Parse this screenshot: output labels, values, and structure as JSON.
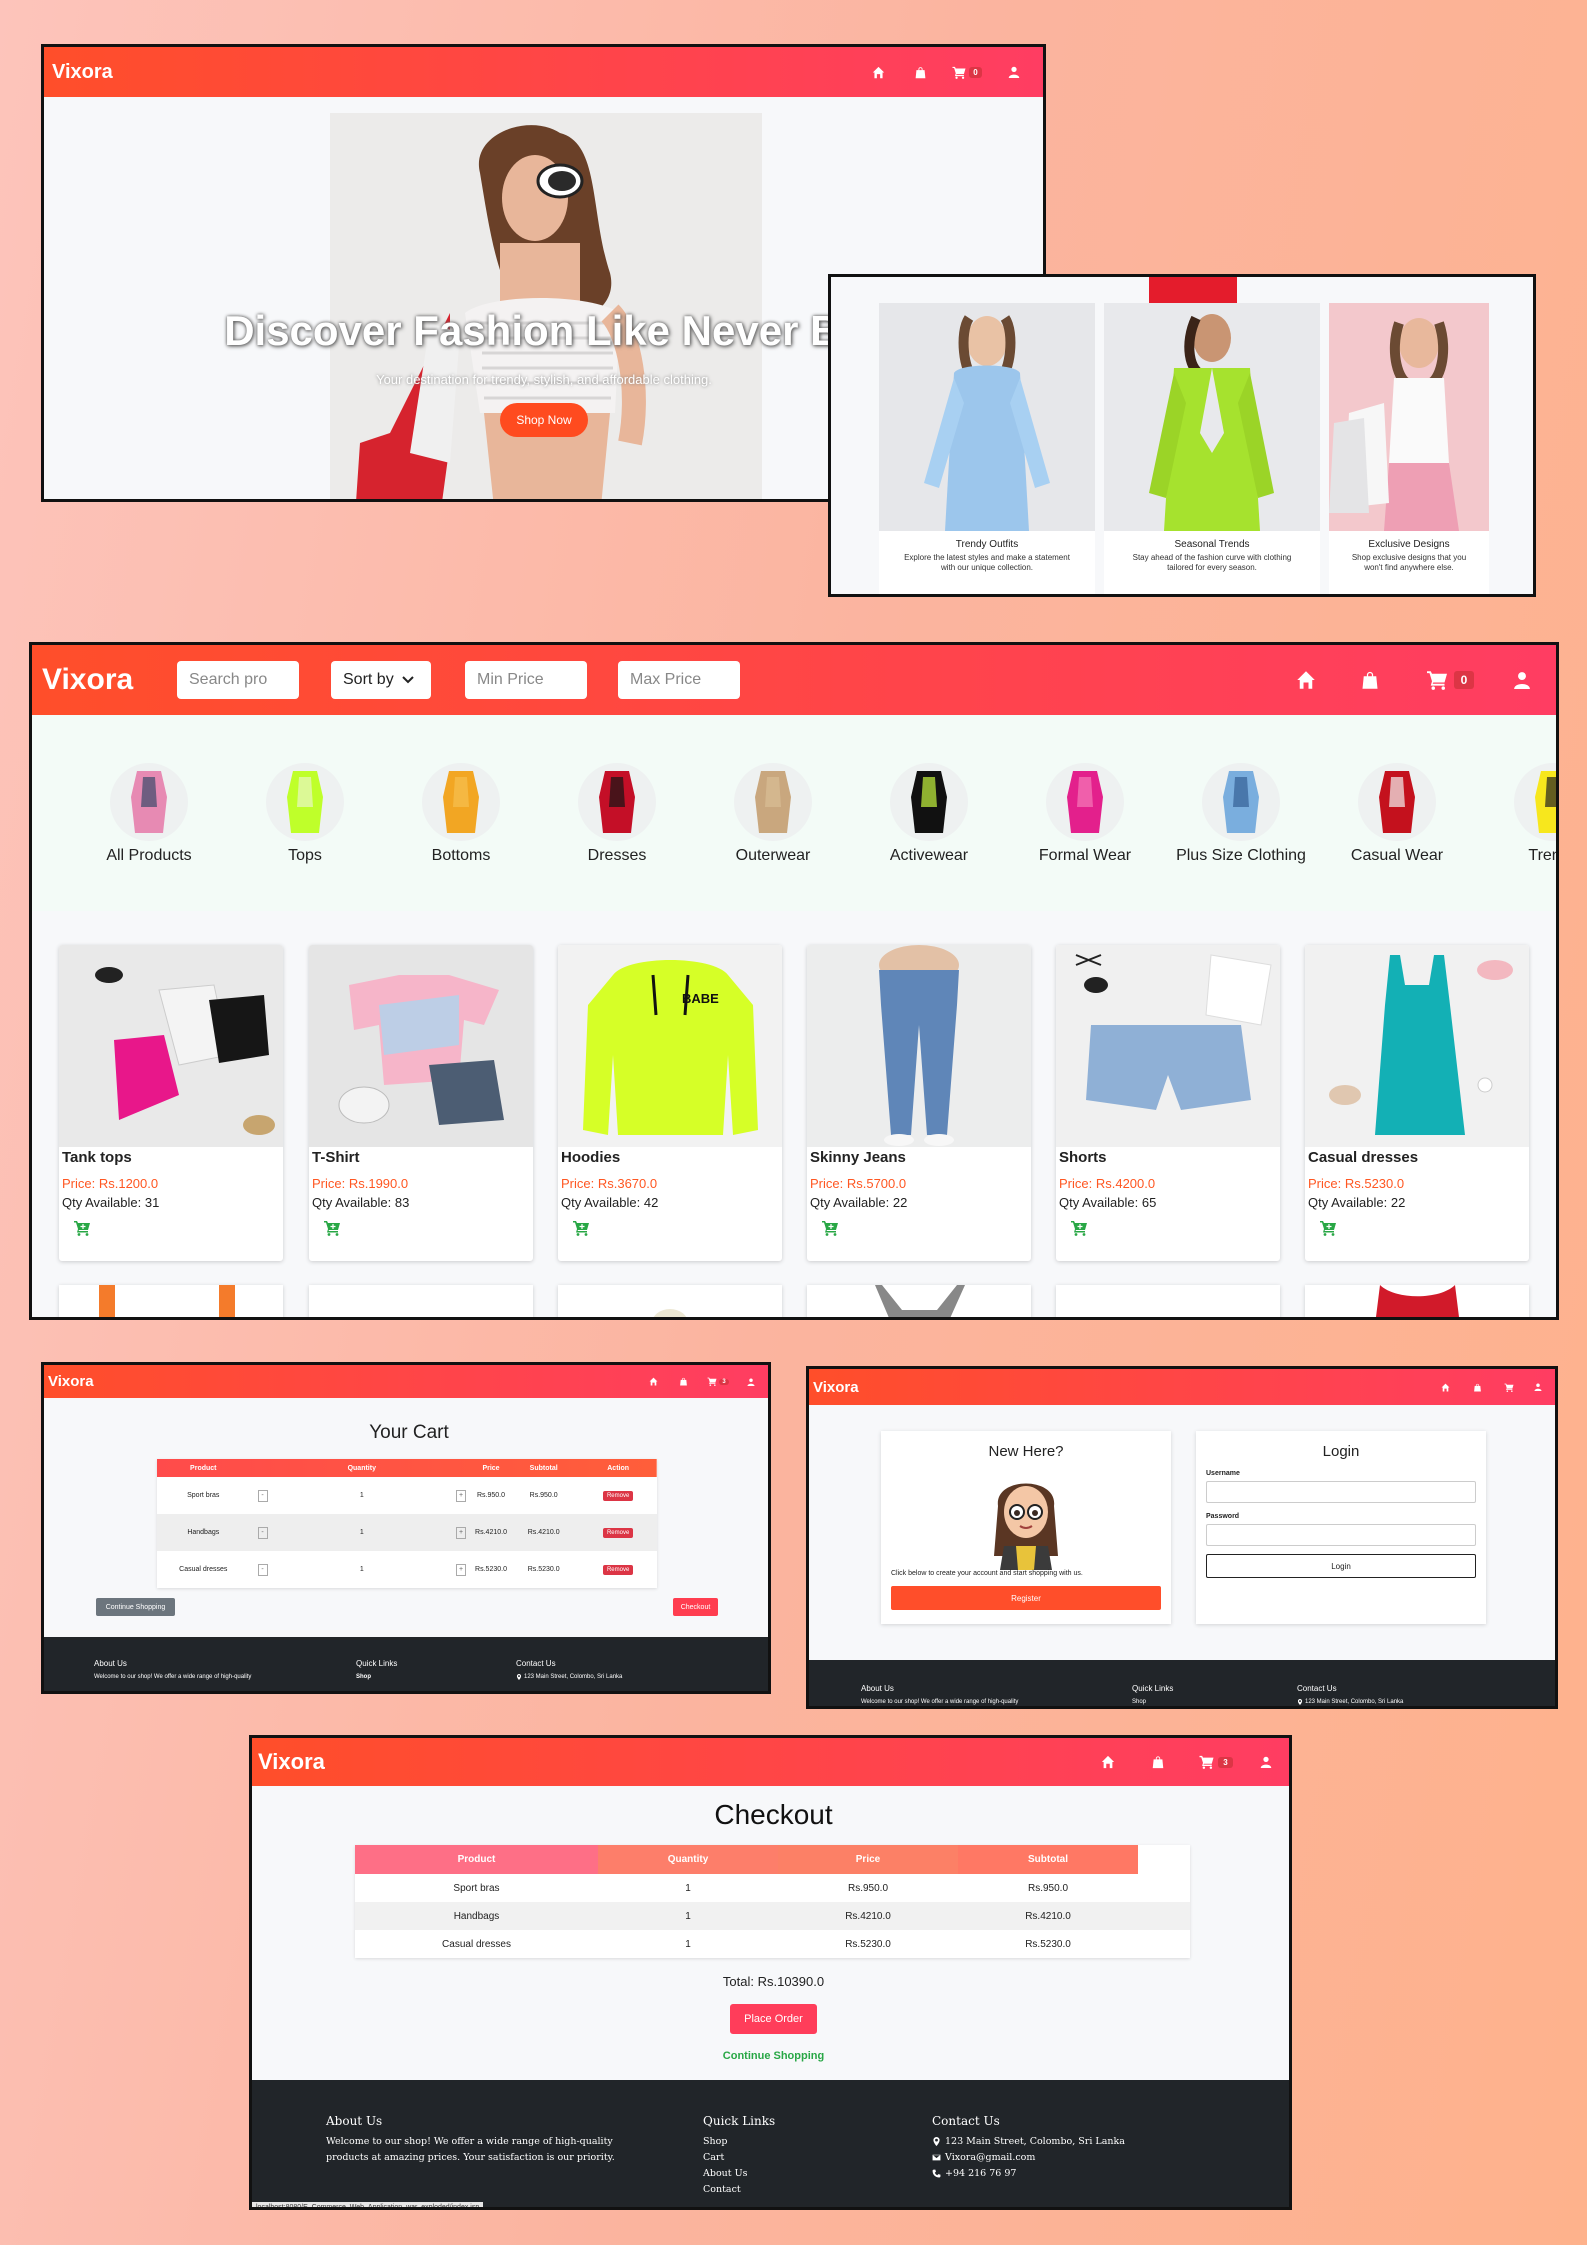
{
  "brand": "Vixora",
  "colors": {
    "accent": "#ff4e2a",
    "accent2": "#ff3d62",
    "price": "#ff5722",
    "green": "#28a745",
    "footer": "#212529"
  },
  "nav_icons": [
    "home-icon",
    "shopping-bag-icon",
    "cart-icon",
    "user-icon"
  ],
  "home": {
    "cart_count": "0",
    "hero_title": "Discover Fashion Like Never Be",
    "hero_subtitle": "Your destination for trendy, stylish, and affordable clothing.",
    "shop_now": "Shop Now",
    "collections": [
      {
        "title": "Trendy Outfits",
        "desc": "Explore the latest styles and make a statement with our unique collection."
      },
      {
        "title": "Seasonal Trends",
        "desc": "Stay ahead of the fashion curve with clothing tailored for every season."
      },
      {
        "title": "Exclusive Designs",
        "desc": "Shop exclusive designs that you won't find anywhere else."
      }
    ]
  },
  "shop": {
    "cart_count": "0",
    "search_placeholder": "Search pro",
    "sort_label": "Sort by",
    "min_price": "Min Price",
    "max_price": "Max Price",
    "categories": [
      "All Products",
      "Tops",
      "Bottoms",
      "Dresses",
      "Outerwear",
      "Activewear",
      "Formal Wear",
      "Plus Size Clothing",
      "Casual Wear",
      "Trendy"
    ],
    "products": [
      {
        "name": "Tank tops",
        "price": "Price: Rs.1200.0",
        "qty": "Qty Available: 31"
      },
      {
        "name": "T-Shirt",
        "price": "Price: Rs.1990.0",
        "qty": "Qty Available: 83"
      },
      {
        "name": "Hoodies",
        "price": "Price: Rs.3670.0",
        "qty": "Qty Available: 42"
      },
      {
        "name": "Skinny Jeans",
        "price": "Price: Rs.5700.0",
        "qty": "Qty Available: 22"
      },
      {
        "name": "Shorts",
        "price": "Price: Rs.4200.0",
        "qty": "Qty Available: 65"
      },
      {
        "name": "Casual dresses",
        "price": "Price: Rs.5230.0",
        "qty": "Qty Available: 22"
      }
    ]
  },
  "cart": {
    "cart_count": "3",
    "title": "Your Cart",
    "headers": [
      "Product",
      "Quantity",
      "Price",
      "Subtotal",
      "Action"
    ],
    "rows": [
      {
        "product": "Sport bras",
        "qty": "1",
        "price": "Rs.950.0",
        "subtotal": "Rs.950.0"
      },
      {
        "product": "Handbags",
        "qty": "1",
        "price": "Rs.4210.0",
        "subtotal": "Rs.4210.0"
      },
      {
        "product": "Casual dresses",
        "qty": "1",
        "price": "Rs.5230.0",
        "subtotal": "Rs.5230.0"
      }
    ],
    "minus": "-",
    "plus": "+",
    "remove": "Remove",
    "continue": "Continue Shopping",
    "checkout": "Checkout",
    "footer_about": "About Us",
    "footer_about_text": "Welcome to our shop! We offer a wide range of high-quality",
    "footer_links": "Quick Links",
    "footer_shop": "Shop",
    "footer_contact": "Contact Us",
    "footer_address": "123 Main Street, Colombo, Sri Lanka"
  },
  "login": {
    "new_here": "New Here?",
    "register_text": "Click below to create your account and start shopping with us.",
    "register_btn": "Register",
    "login_title": "Login",
    "username_label": "Username",
    "password_label": "Password",
    "login_btn": "Login",
    "footer_about": "About Us",
    "footer_about_text": "Welcome to our shop! We offer a wide range of high-quality",
    "footer_links": "Quick Links",
    "footer_shop": "Shop",
    "footer_contact": "Contact Us",
    "footer_address": "123 Main Street, Colombo, Sri Lanka"
  },
  "checkout": {
    "cart_count": "3",
    "title": "Checkout",
    "headers": [
      "Product",
      "Quantity",
      "Price",
      "Subtotal"
    ],
    "rows": [
      {
        "product": "Sport bras",
        "qty": "1",
        "price": "Rs.950.0",
        "subtotal": "Rs.950.0"
      },
      {
        "product": "Handbags",
        "qty": "1",
        "price": "Rs.4210.0",
        "subtotal": "Rs.4210.0"
      },
      {
        "product": "Casual dresses",
        "qty": "1",
        "price": "Rs.5230.0",
        "subtotal": "Rs.5230.0"
      }
    ],
    "total": "Total: Rs.10390.0",
    "place_order": "Place Order",
    "continue": "Continue Shopping",
    "footer": {
      "about_title": "About Us",
      "about_text_1": "Welcome to our shop! We offer a wide range of high-quality",
      "about_text_2": "products at amazing prices. Your satisfaction is our priority.",
      "links_title": "Quick Links",
      "links": [
        "Shop",
        "Cart",
        "About Us",
        "Contact"
      ],
      "contact_title": "Contact Us",
      "address": "123 Main Street, Colombo, Sri Lanka",
      "email": "Vixora@gmail.com",
      "phone": "+94 216 76 97"
    },
    "status_bar": "localhost:8080/E_Commerce_Web_Application_war_exploded/index.jsp"
  }
}
